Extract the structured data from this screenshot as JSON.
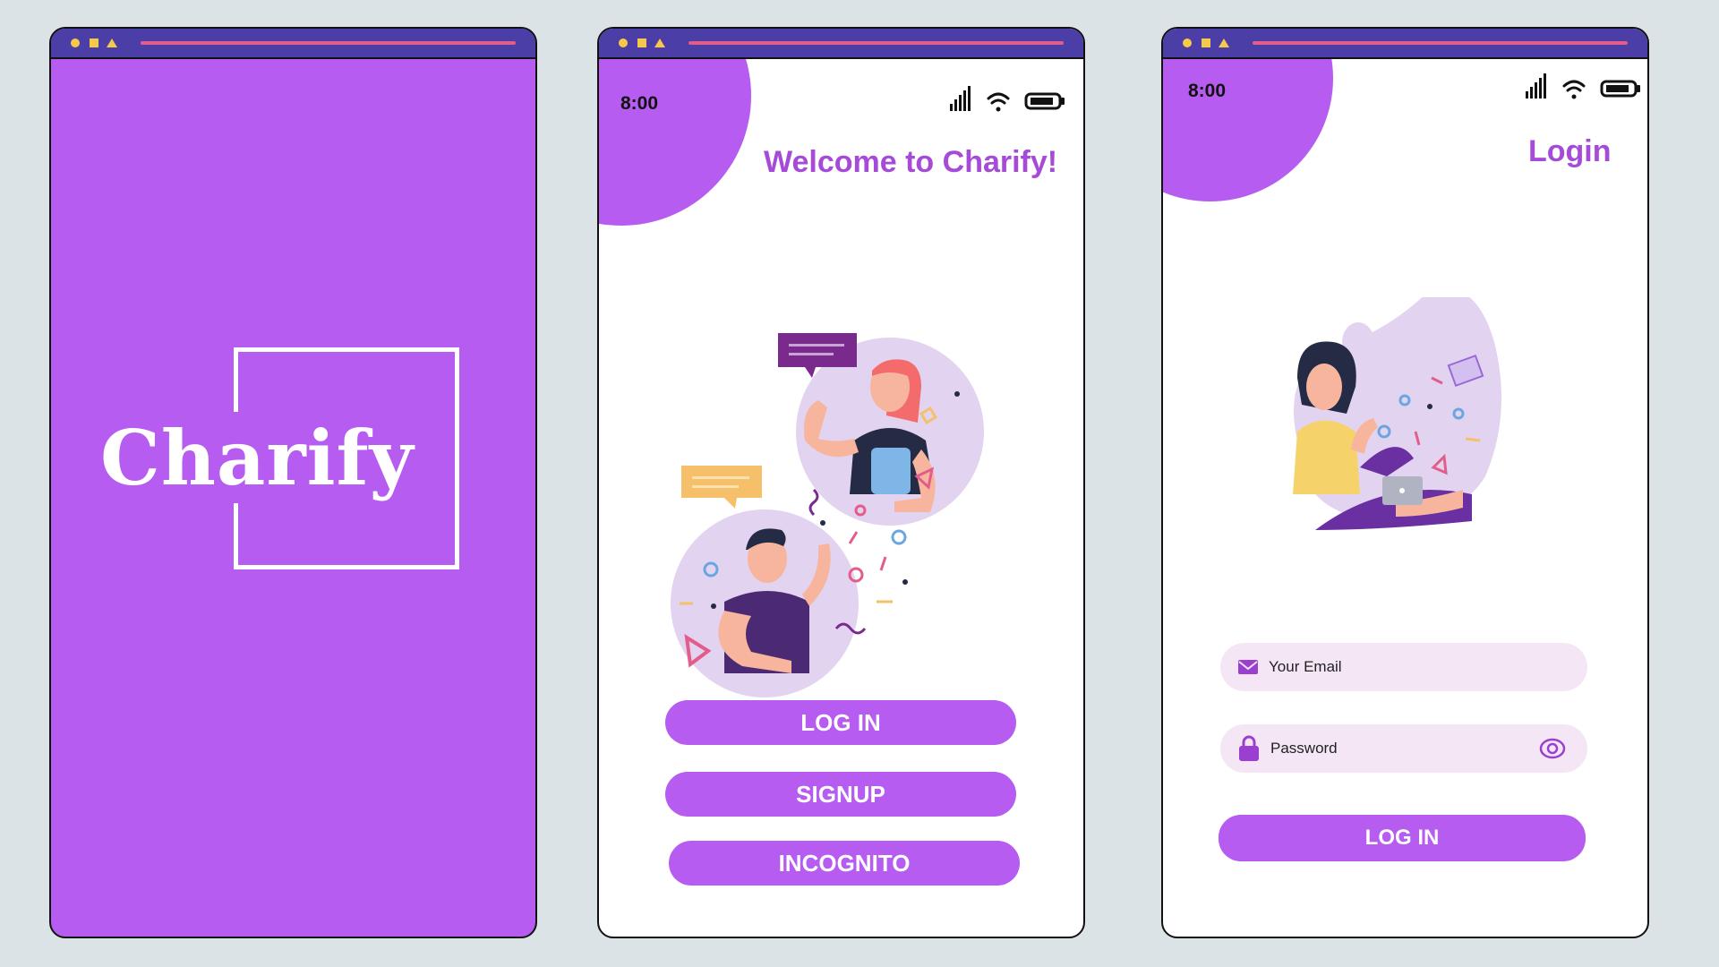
{
  "splash": {
    "brand": "Charify"
  },
  "welcome": {
    "time": "8:00",
    "title": "Welcome to Charify!",
    "buttons": {
      "login": "LOG IN",
      "signup": "SIGNUP",
      "incognito": "INCOGNITO"
    }
  },
  "login": {
    "time": "8:00",
    "title": "Login",
    "email_placeholder": "Your Email",
    "password_placeholder": "Password",
    "submit": "LOG IN"
  },
  "colors": {
    "accent": "#b65cf0",
    "heading": "#a64bd8",
    "field_bg": "#f5e6f6",
    "topbar": "#4b3ea6"
  }
}
